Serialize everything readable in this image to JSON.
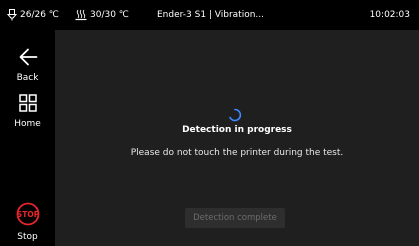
{
  "status_bar": {
    "nozzle_temp": "26/26 ℃",
    "bed_temp": "30/30 ℃",
    "title": "Ender-3 S1 | Vibration...",
    "clock": "10:02:03"
  },
  "sidebar": {
    "back_label": "Back",
    "home_label": "Home",
    "stop_icon_text": "STOP",
    "stop_label": "Stop"
  },
  "main": {
    "title": "Detection in progress",
    "message": "Please do not touch the printer during the test.",
    "complete_button": "Detection complete"
  },
  "colors": {
    "background": "#000000",
    "panel": "#1f1f1f",
    "accent_blue": "#3d8bff",
    "stop_red": "#e5262a",
    "disabled_button": "#2e2e2e",
    "disabled_text": "#6c6c6c"
  }
}
